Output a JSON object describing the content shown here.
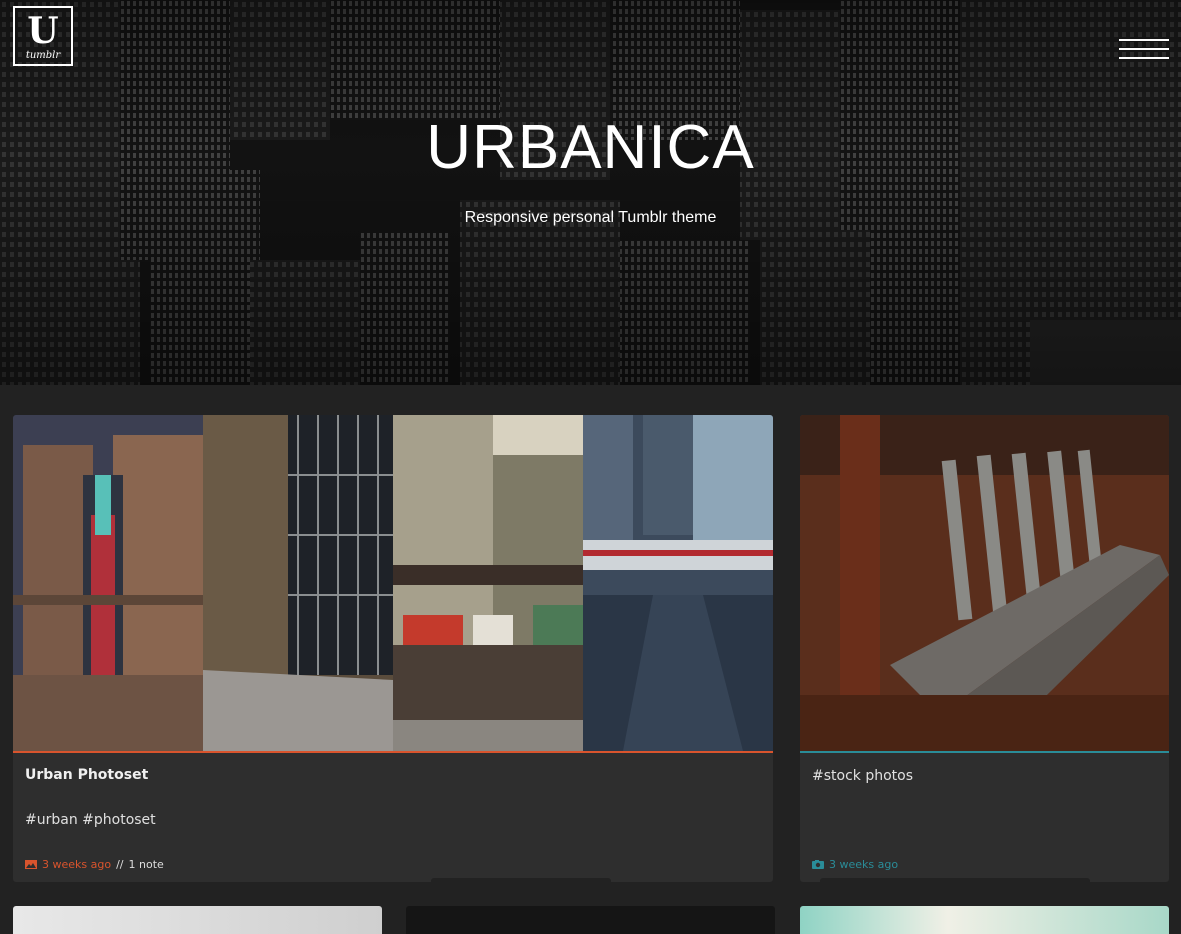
{
  "header": {
    "logo_letter": "U",
    "logo_caption": "tumblr",
    "title": "URBANICA",
    "description": "Responsive personal Tumblr theme"
  },
  "posts": [
    {
      "title": "Urban Photoset",
      "tags": "#urban #photoset",
      "date": "3 weeks ago",
      "separator": "//",
      "notes": "1 note",
      "icon": "photo-icon",
      "accent": "#d9542d"
    },
    {
      "tags": "#stock photos",
      "date": "3 weeks ago",
      "icon": "camera-icon",
      "accent": "#2a8c98"
    }
  ]
}
